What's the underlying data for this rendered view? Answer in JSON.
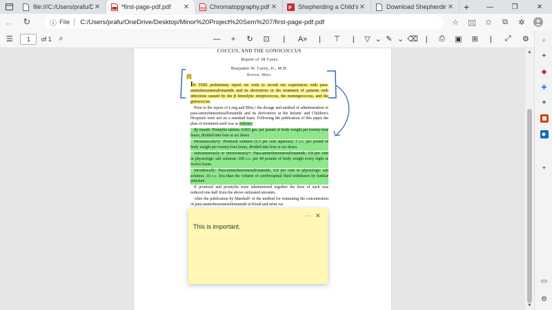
{
  "tabs": [
    {
      "title": "file:///C:/Users/prafu/Dow",
      "active": false
    },
    {
      "title": "*first-page-pdf.pdf",
      "active": true
    },
    {
      "title": "Chromatopgraphy.pdf",
      "active": false
    },
    {
      "title": "Shepherding a Child's Hea",
      "active": false
    },
    {
      "title": "Download Shepherding a",
      "active": false
    }
  ],
  "address": {
    "label": "File",
    "url": "C:/Users/prafu/OneDrive/Desktop/Minor%20Project%20Sem%207/first-page-pdf.pdf"
  },
  "pdf_toolbar": {
    "page_number": "1",
    "page_total": "of 1"
  },
  "document": {
    "title": "COCCUS, AND THE GONOCOCCUS",
    "report": "Report of 38 Cases",
    "author": "Benjamin W. Carey, Jr., M.D.",
    "location": "Boston, Mass.",
    "p1": "N THIS preliminary report we wish to record our experiences with para-aminobenzenesulfonamide and its derivatives in the treatment of patients with infections caused by the β hemolytic streptococcus, the meningococcus, and the gonococcus.",
    "p1_drop": "I",
    "p2": "Prior to the report of Long and Bliss,¹ the dosage and method of administration of para-aminobenzenesulfonamide and its derivatives at the Infants' and Children's Hospitals were not on a standard basis. Following the publication of this paper the plan of treatment used was as",
    "p2_hl": "follows:",
    "p3_head": "By mouth:",
    "p3": "Prontylin tablets; 0.065 gm. per pound of body weight per twenty-four hours, divided into four or six doses.",
    "p4_head": "Intramuscularly:",
    "p4": "Prontosil solution (2.5 per cent aqueous); 1 c.c. per pound of body weight per twenty-four hours, divided into four or six doses.",
    "p5_head": "Subcutaneously or intravenously*:",
    "p5": "Para-aminobenzenesulfonamide, 0.8 per cent in physiologic salt solution; 100 c.c. per 40 pounds of body weight every eight or twelve hours.",
    "p6_head": "Intrathecally:",
    "p6": "Para-aminobenzenesulfonamide, 0.8 per cent in physiologic salt solution; 10 c.c. less than the volume of cerebrospinal fluid withdrawn by lumbar puncture.",
    "p7": "If prontosil and prontylin were administered together the dose of each was reduced one-half from the above estimated amounts.",
    "p8": "After the publication by Marshall² of the method for estimating the concentration of para-aminobenzenesulfonamide in blood and urine we"
  },
  "note": {
    "text": "This is important.",
    "more": "···",
    "close": "✕"
  },
  "colors": {
    "highlight_yellow": "#fdf06b",
    "highlight_green": "#8ee88b",
    "ink_blue": "#2e5fb8",
    "note_bg": "#fff7b3"
  }
}
